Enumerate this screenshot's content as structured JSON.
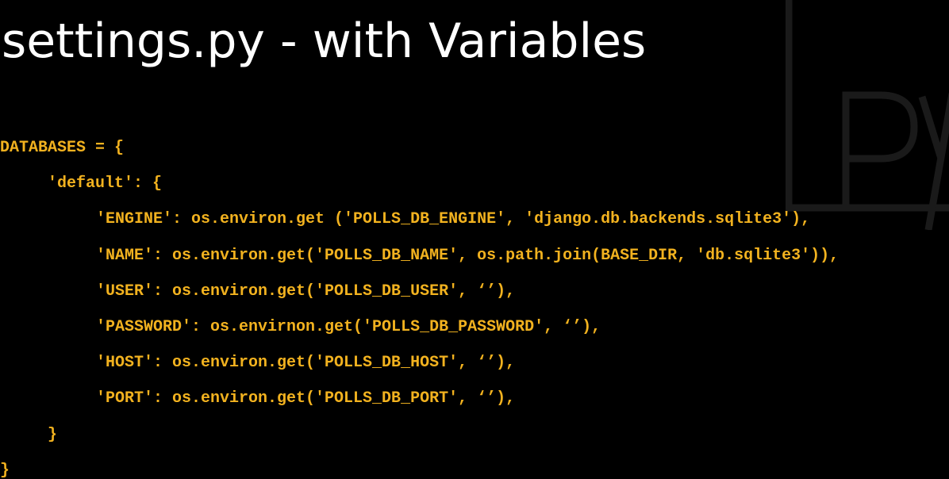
{
  "slide": {
    "title": "settings.py - with Variables",
    "background_color": "#000000",
    "title_color": "#ffffff",
    "code_color": "#f2b21f",
    "watermark_icon": "python-py-watermark-icon"
  },
  "code": {
    "lines": [
      "DATABASES = {",
      "'default': {",
      "'ENGINE': os.environ.get ('POLLS_DB_ENGINE', 'django.db.backends.sqlite3'),",
      "'NAME': os.environ.get('POLLS_DB_NAME', os.path.join(BASE_DIR, 'db.sqlite3')),",
      "'USER': os.environ.get('POLLS_DB_USER', ‘’),",
      "'PASSWORD': os.envirnon.get('POLLS_DB_PASSWORD', ‘’),",
      "'HOST': os.environ.get('POLLS_DB_HOST', ‘’),",
      "'PORT': os.environ.get('POLLS_DB_PORT', ‘’),",
      "}",
      "}"
    ]
  }
}
